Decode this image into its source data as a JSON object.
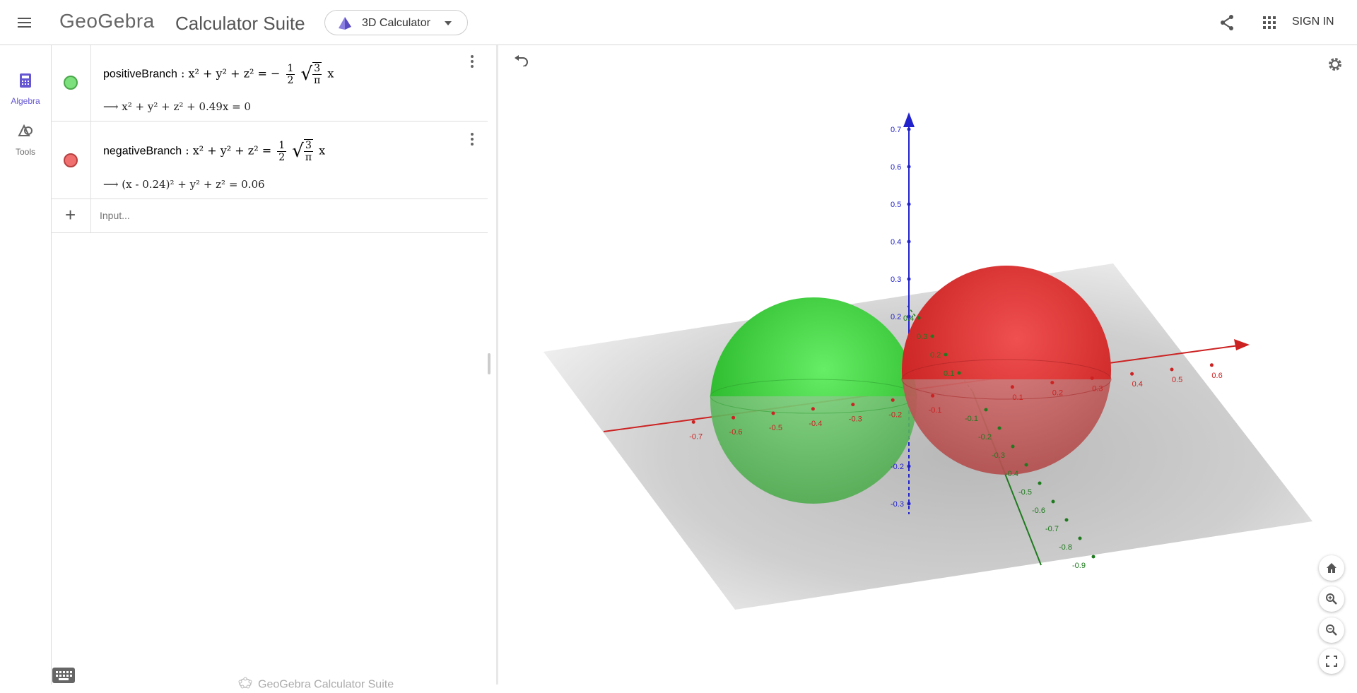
{
  "header": {
    "logo": "GeoGebra",
    "suite_title": "Calculator Suite",
    "app_selector": "3D Calculator",
    "sign_in": "SIGN IN"
  },
  "rail": {
    "algebra_label": "Algebra",
    "tools_label": "Tools",
    "active_color": "#6557d2"
  },
  "algebra": {
    "items": [
      {
        "name": "positiveBranch",
        "definition_lhs": "x² + y² + z² =",
        "definition_sign": "−",
        "frac_num": "1",
        "frac_den": "2",
        "root_num": "3",
        "root_den": "π",
        "definition_var": "x",
        "output": "x² + y² + z² + 0.49x = 0",
        "color": "#7ce07c"
      },
      {
        "name": "negativeBranch",
        "definition_lhs": "x² + y² + z² =",
        "definition_sign": "",
        "frac_num": "1",
        "frac_den": "2",
        "root_num": "3",
        "root_den": "π",
        "definition_var": "x",
        "output": "(x - 0.24)² + y² + z² = 0.06",
        "color": "#f07070"
      }
    ],
    "input_placeholder": "Input...",
    "footer": "GeoGebra Calculator Suite"
  },
  "graphics": {
    "z_ticks": [
      "0.7",
      "0.6",
      "0.5",
      "0.4",
      "0.3",
      "0.2",
      "-0.2",
      "-0.3"
    ],
    "x_ticks_neg": [
      "-0.7",
      "-0.6",
      "-0.5",
      "-0.4",
      "-0.3",
      "-0.2",
      "-0.1"
    ],
    "x_ticks_pos": [
      "0.1",
      "0.2",
      "0.3",
      "0.4",
      "0.5",
      "0.6"
    ],
    "y_ticks_pos": [
      "0.4",
      "0.3",
      "0.2",
      "0.1"
    ],
    "y_ticks_neg": [
      "-0.1",
      "-0.2",
      "-0.3",
      "-0.4",
      "-0.5",
      "-0.6",
      "-0.7",
      "-0.8",
      "-0.9"
    ],
    "x_axis_color": "#cc2222",
    "y_axis_color": "#1f7a1f",
    "z_axis_color": "#2222cc",
    "sphere_green": "#33cc33",
    "sphere_red": "#dd2a2a"
  }
}
